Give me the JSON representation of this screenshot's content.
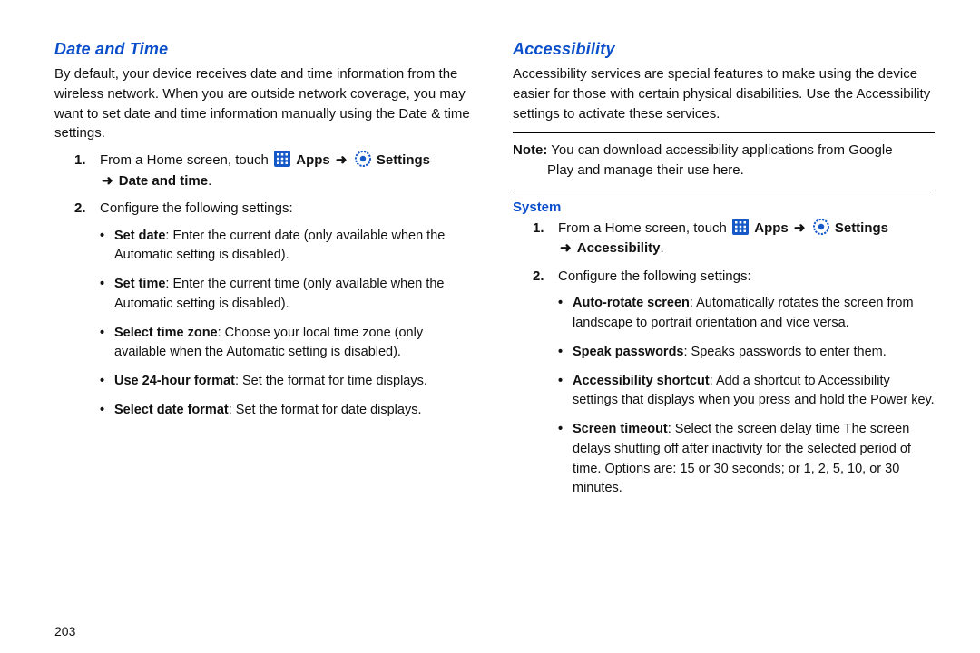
{
  "left": {
    "heading": "Date and Time",
    "intro": "By default, your device receives date and time information from the wireless network. When you are outside network coverage, you may want to set date and time information manually using the Date & time settings.",
    "step1_prefix": "From a Home screen, touch",
    "apps_label": "Apps",
    "settings_label": "Settings",
    "step1_tail": "Date and time",
    "step2": "Configure the following settings:",
    "bullets": {
      "set_date_label": "Set date",
      "set_date_desc": ": Enter the current date (only available when the Automatic setting is disabled).",
      "set_time_label": "Set time",
      "set_time_desc": ": Enter the current time (only available when the Automatic setting is disabled).",
      "select_tz_label": "Select time zone",
      "select_tz_desc": ": Choose your local time zone (only available when the Automatic setting is disabled).",
      "use24_label": "Use 24-hour format",
      "use24_desc": ": Set the format for time displays.",
      "select_df_label": "Select date format",
      "select_df_desc": ": Set the format for date displays."
    }
  },
  "right": {
    "heading": "Accessibility",
    "intro": "Accessibility services are special features to make using the device easier for those with certain physical disabilities. Use the Accessibility settings to activate these services.",
    "note_label": "Note:",
    "note_first": " You can download accessibility applications from Google",
    "note_rest": "Play and manage their use here.",
    "subheading": "System",
    "step1_prefix": "From a Home screen, touch",
    "apps_label": "Apps",
    "settings_label": "Settings",
    "step1_tail": "Accessibility",
    "step2": "Configure the following settings:",
    "bullets": {
      "autorotate_label": "Auto-rotate screen",
      "autorotate_desc": ": Automatically rotates the screen from landscape to portrait orientation and vice versa.",
      "speakpw_label": "Speak passwords",
      "speakpw_desc": ": Speaks passwords to enter them.",
      "shortcut_label": "Accessibility shortcut",
      "shortcut_desc": ": Add a shortcut to Accessibility settings that displays when you press and hold the Power key.",
      "timeout_label": "Screen timeout",
      "timeout_desc": ": Select the screen delay time The screen delays shutting off after inactivity for the selected period of time. Options are: 15 or 30 seconds; or 1, 2, 5, 10, or 30 minutes."
    }
  },
  "page_number": "203",
  "arrow": "➜"
}
